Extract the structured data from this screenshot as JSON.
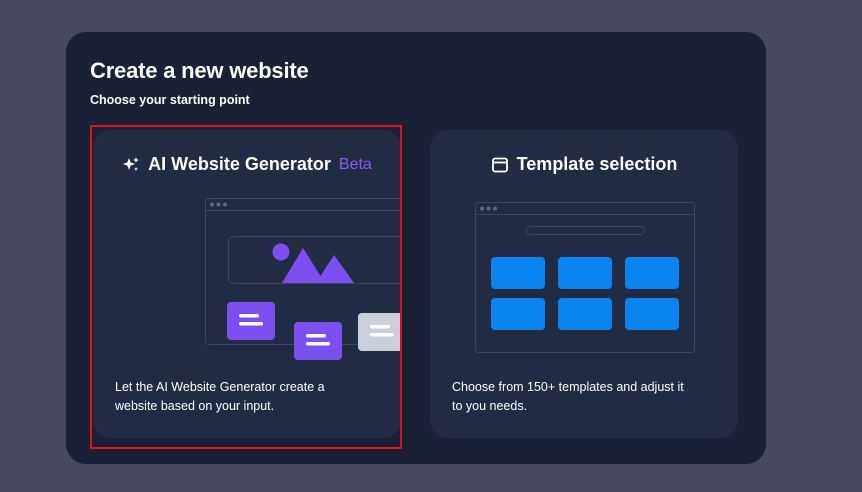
{
  "modal": {
    "title": "Create a new website",
    "subtitle": "Choose your starting point"
  },
  "cards": {
    "ai": {
      "icon": "sparkles-icon",
      "title": "AI Website Generator",
      "badge": "Beta",
      "description": "Let the AI Website Generator create a website based on your input.",
      "selected": true
    },
    "template": {
      "icon": "browser-window-icon",
      "title": "Template selection",
      "description": "Choose from 150+ templates and adjust it to you needs.",
      "selected": false
    }
  },
  "colors": {
    "page_background": "#474a5c",
    "modal_background": "#1a2036",
    "card_background": "#222b44",
    "accent_purple": "#7b4ff0",
    "accent_blue": "#0a84f0",
    "light_chip": "#c9d0dc",
    "selection_outline": "#e0141e",
    "badge_text": "#8a5cf0"
  }
}
